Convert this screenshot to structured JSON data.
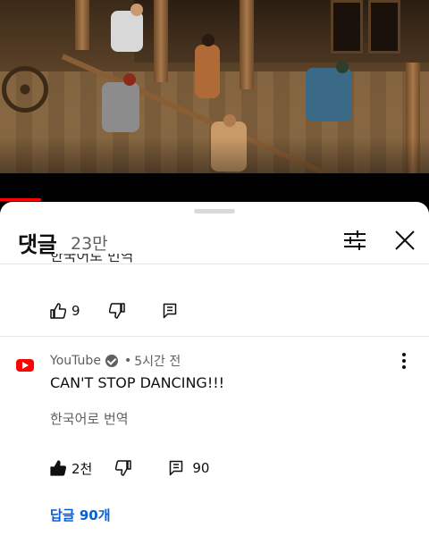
{
  "video": {
    "progress_fraction": 0.096,
    "accent": "#ff0000"
  },
  "comments_panel": {
    "title": "댓글",
    "count": "23만",
    "filter_icon": "sliders-icon",
    "close_icon": "close-icon"
  },
  "comments": [
    {
      "partial_text": "한국어로 번역",
      "likes": "9",
      "replies_count": ""
    },
    {
      "author": "YouTube",
      "verified": true,
      "time": "5시간 전",
      "text": "CAN'T STOP DANCING!!!",
      "translate_label": "한국어로 번역",
      "likes": "2천",
      "liked": true,
      "replies_count": "90",
      "view_replies_label": "답글 90개"
    }
  ],
  "meta_separator": "•",
  "colors": {
    "link": "#065fd4",
    "secondary_text": "#606060",
    "brand_red": "#ff0000"
  }
}
